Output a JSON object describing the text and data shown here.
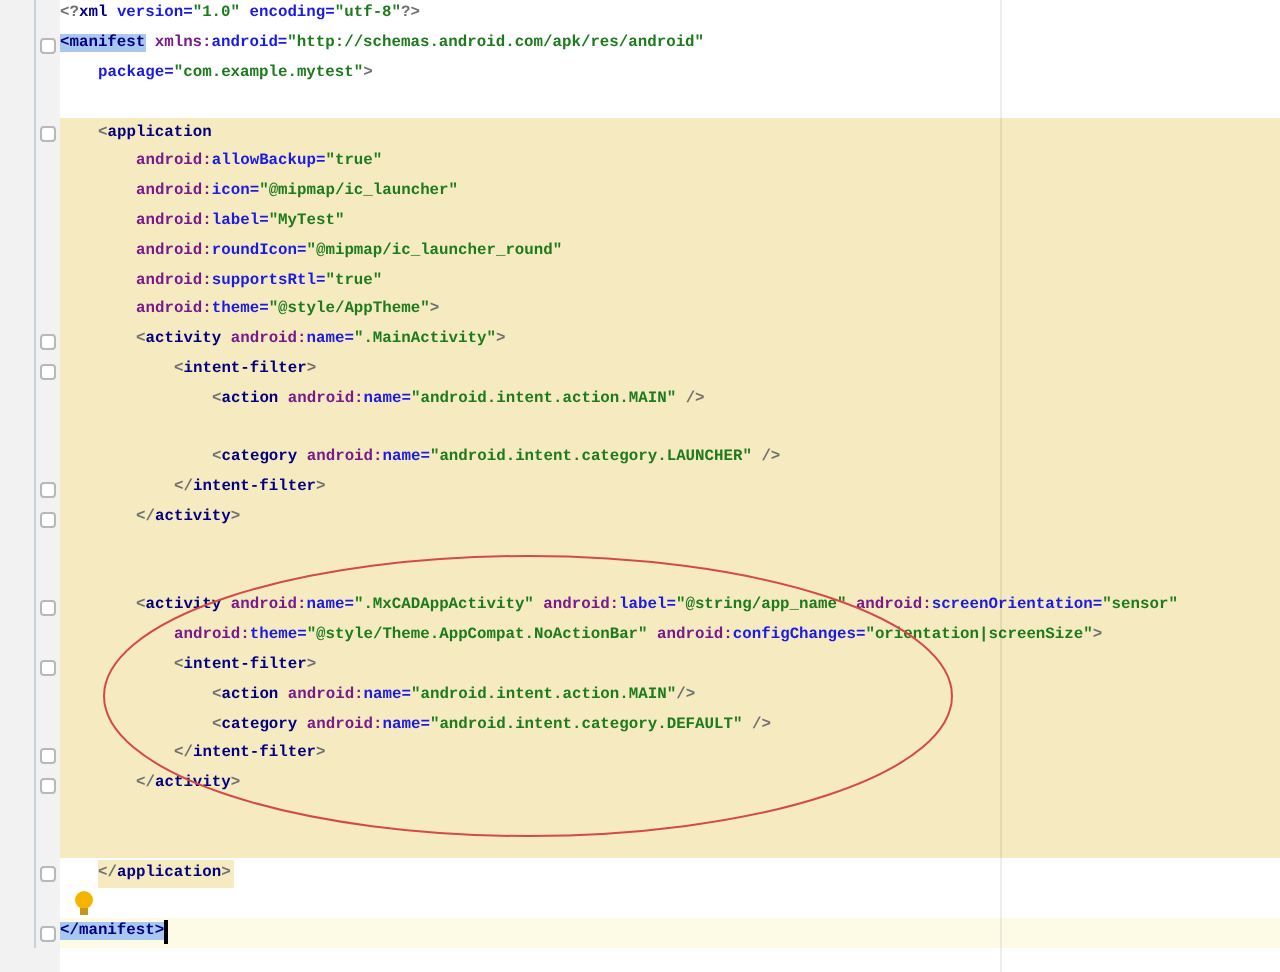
{
  "editor": {
    "prolog_lines": [
      {
        "kind": "code",
        "tokens": [
          {
            "kind": "punct",
            "text": "<?"
          },
          {
            "kind": "tag",
            "text": "xml"
          },
          {
            "kind": "attr",
            "text": " version="
          },
          {
            "kind": "value",
            "text": "\"1.0\""
          },
          {
            "kind": "attr",
            "text": " encoding="
          },
          {
            "kind": "value",
            "text": "\"utf-8\""
          },
          {
            "kind": "punct",
            "text": "?>"
          }
        ]
      },
      {
        "kind": "fold",
        "tokens": [
          {
            "kind": "match",
            "text": "<manifest"
          },
          {
            "kind": "ns",
            "text": " xmlns:"
          },
          {
            "kind": "attr",
            "text": "android="
          },
          {
            "kind": "value",
            "text": "\"http://schemas.android.com/apk/res/android\""
          }
        ]
      },
      {
        "kind": "code",
        "tokens": [
          {
            "kind": "attr",
            "text": "    package="
          },
          {
            "kind": "value",
            "text": "\"com.example.mytest\""
          },
          {
            "kind": "punct",
            "text": ">"
          }
        ]
      },
      {
        "kind": "blank"
      }
    ],
    "application_block": {
      "lines": [
        {
          "kind": "fold",
          "tokens": [
            {
              "kind": "punct",
              "text": "    <"
            },
            {
              "kind": "tag",
              "text": "application"
            }
          ]
        },
        {
          "kind": "code",
          "tokens": [
            {
              "kind": "ns",
              "text": "        android:"
            },
            {
              "kind": "attr",
              "text": "allowBackup="
            },
            {
              "kind": "value",
              "text": "\"true\""
            }
          ]
        },
        {
          "kind": "code",
          "tokens": [
            {
              "kind": "ns",
              "text": "        android:"
            },
            {
              "kind": "attr",
              "text": "icon="
            },
            {
              "kind": "value",
              "text": "\"@mipmap/ic_launcher\""
            }
          ]
        },
        {
          "kind": "code",
          "tokens": [
            {
              "kind": "ns",
              "text": "        android:"
            },
            {
              "kind": "attr",
              "text": "label="
            },
            {
              "kind": "value",
              "text": "\"MyTest\""
            }
          ]
        },
        {
          "kind": "code",
          "tokens": [
            {
              "kind": "ns",
              "text": "        android:"
            },
            {
              "kind": "attr",
              "text": "roundIcon="
            },
            {
              "kind": "value",
              "text": "\"@mipmap/ic_launcher_round\""
            }
          ]
        },
        {
          "kind": "code",
          "tokens": [
            {
              "kind": "ns",
              "text": "        android:"
            },
            {
              "kind": "attr",
              "text": "supportsRtl="
            },
            {
              "kind": "value",
              "text": "\"true\""
            }
          ]
        },
        {
          "kind": "code",
          "tokens": [
            {
              "kind": "ns",
              "text": "        android:"
            },
            {
              "kind": "attr",
              "text": "theme="
            },
            {
              "kind": "value",
              "text": "\"@style/AppTheme\""
            },
            {
              "kind": "punct",
              "text": ">"
            }
          ]
        },
        {
          "kind": "fold",
          "tokens": [
            {
              "kind": "punct",
              "text": "        <"
            },
            {
              "kind": "tag",
              "text": "activity"
            },
            {
              "kind": "ns",
              "text": " android:"
            },
            {
              "kind": "attr",
              "text": "name="
            },
            {
              "kind": "value",
              "text": "\".MainActivity\""
            },
            {
              "kind": "punct",
              "text": ">"
            }
          ]
        },
        {
          "kind": "fold",
          "tokens": [
            {
              "kind": "punct",
              "text": "            <"
            },
            {
              "kind": "tag",
              "text": "intent-filter"
            },
            {
              "kind": "punct",
              "text": ">"
            }
          ]
        },
        {
          "kind": "code",
          "tokens": [
            {
              "kind": "punct",
              "text": "                <"
            },
            {
              "kind": "tag",
              "text": "action"
            },
            {
              "kind": "ns",
              "text": " android:"
            },
            {
              "kind": "attr",
              "text": "name="
            },
            {
              "kind": "value",
              "text": "\"android.intent.action.MAIN\""
            },
            {
              "kind": "punct",
              "text": " />"
            }
          ]
        },
        {
          "kind": "blank"
        },
        {
          "kind": "code",
          "tokens": [
            {
              "kind": "punct",
              "text": "                <"
            },
            {
              "kind": "tag",
              "text": "category"
            },
            {
              "kind": "ns",
              "text": " android:"
            },
            {
              "kind": "attr",
              "text": "name="
            },
            {
              "kind": "value",
              "text": "\"android.intent.category.LAUNCHER\""
            },
            {
              "kind": "punct",
              "text": " />"
            }
          ]
        },
        {
          "kind": "fold",
          "tokens": [
            {
              "kind": "punct",
              "text": "            </"
            },
            {
              "kind": "tag",
              "text": "intent-filter"
            },
            {
              "kind": "punct",
              "text": ">"
            }
          ]
        },
        {
          "kind": "fold",
          "tokens": [
            {
              "kind": "punct",
              "text": "        </"
            },
            {
              "kind": "tag",
              "text": "activity"
            },
            {
              "kind": "punct",
              "text": ">"
            }
          ]
        },
        {
          "kind": "blank"
        },
        {
          "kind": "blank"
        },
        {
          "kind": "fold",
          "tokens": [
            {
              "kind": "punct",
              "text": "        <"
            },
            {
              "kind": "tag",
              "text": "activity"
            },
            {
              "kind": "ns",
              "text": " android:"
            },
            {
              "kind": "attr",
              "text": "name="
            },
            {
              "kind": "value",
              "text": "\".MxCADAppActivity\""
            },
            {
              "kind": "ns",
              "text": " android:"
            },
            {
              "kind": "attr",
              "text": "label="
            },
            {
              "kind": "value",
              "text": "\"@string/app_name\""
            },
            {
              "kind": "ns",
              "text": " android:"
            },
            {
              "kind": "attr",
              "text": "screenOrientation="
            },
            {
              "kind": "value",
              "text": "\"sensor\""
            }
          ]
        },
        {
          "kind": "code",
          "tokens": [
            {
              "kind": "ns",
              "text": "            android:"
            },
            {
              "kind": "attr",
              "text": "theme="
            },
            {
              "kind": "value",
              "text": "\"@style/Theme.AppCompat.NoActionBar\""
            },
            {
              "kind": "ns",
              "text": " android:"
            },
            {
              "kind": "attr",
              "text": "configChanges="
            },
            {
              "kind": "value",
              "text": "\"orientation|screenSize\""
            },
            {
              "kind": "punct",
              "text": ">"
            }
          ]
        },
        {
          "kind": "fold",
          "tokens": [
            {
              "kind": "punct",
              "text": "            <"
            },
            {
              "kind": "tag",
              "text": "intent-filter"
            },
            {
              "kind": "punct",
              "text": ">"
            }
          ]
        },
        {
          "kind": "code",
          "tokens": [
            {
              "kind": "punct",
              "text": "                <"
            },
            {
              "kind": "tag",
              "text": "action"
            },
            {
              "kind": "ns",
              "text": " android:"
            },
            {
              "kind": "attr",
              "text": "name="
            },
            {
              "kind": "value",
              "text": "\"android.intent.action.MAIN\""
            },
            {
              "kind": "punct",
              "text": "/>"
            }
          ]
        },
        {
          "kind": "code",
          "tokens": [
            {
              "kind": "punct",
              "text": "                <"
            },
            {
              "kind": "tag",
              "text": "category"
            },
            {
              "kind": "ns",
              "text": " android:"
            },
            {
              "kind": "attr",
              "text": "name="
            },
            {
              "kind": "value",
              "text": "\"android.intent.category.DEFAULT\""
            },
            {
              "kind": "punct",
              "text": " />"
            }
          ]
        },
        {
          "kind": "fold",
          "tokens": [
            {
              "kind": "punct",
              "text": "            </"
            },
            {
              "kind": "tag",
              "text": "intent-filter"
            },
            {
              "kind": "punct",
              "text": ">"
            }
          ]
        },
        {
          "kind": "fold",
          "tokens": [
            {
              "kind": "punct",
              "text": "        </"
            },
            {
              "kind": "tag",
              "text": "activity"
            },
            {
              "kind": "punct",
              "text": ">"
            }
          ]
        },
        {
          "kind": "blank"
        },
        {
          "kind": "blank"
        }
      ]
    },
    "closing_lines": [
      {
        "kind": "scope_end",
        "tokens": [
          {
            "kind": "punct",
            "text": "    </"
          },
          {
            "kind": "tag",
            "text": "application"
          },
          {
            "kind": "punct",
            "text": ">"
          }
        ]
      },
      {
        "kind": "bulb"
      },
      {
        "kind": "cursor",
        "tokens": [
          {
            "kind": "match",
            "text": "</manifest>"
          }
        ]
      }
    ]
  }
}
